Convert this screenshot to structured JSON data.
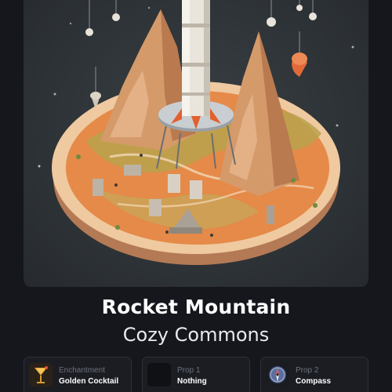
{
  "card": {
    "title": "Rocket Mountain",
    "subtitle": "Cozy Commons"
  },
  "slots": [
    {
      "kind": "Enchantment",
      "name": "Golden Cocktail",
      "icon": "cocktail-icon"
    },
    {
      "kind": "Prop 1",
      "name": "Nothing",
      "icon": "empty-slot-icon"
    },
    {
      "kind": "Prop 2",
      "name": "Compass",
      "icon": "compass-icon"
    }
  ],
  "colors": {
    "background": "#15171d",
    "hero_background": "#2f3438",
    "terrain": "#e07a3a",
    "rock": "#d59a6a",
    "slot_border": "#2d3038"
  }
}
